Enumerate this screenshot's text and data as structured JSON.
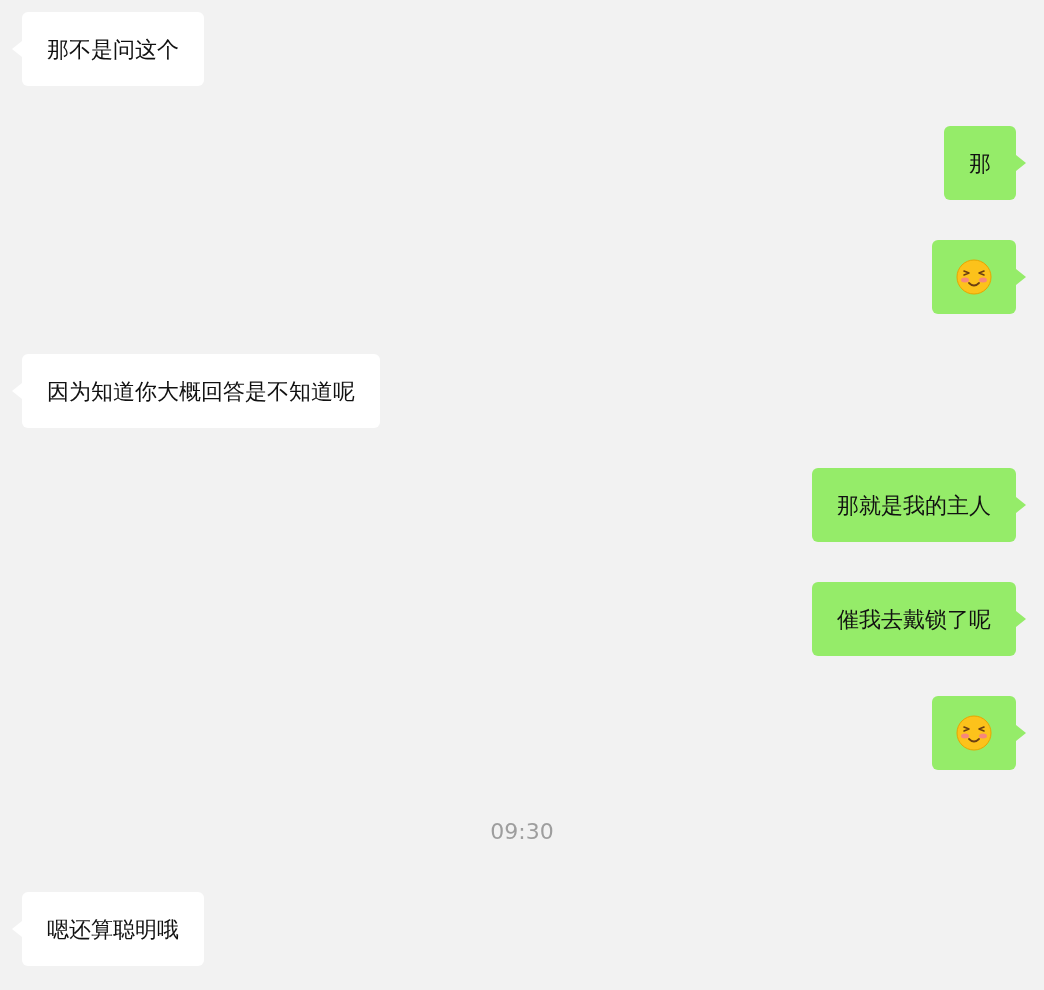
{
  "messages": [
    {
      "kind": "text",
      "outgoing": false,
      "text": "那不是问这个"
    },
    {
      "kind": "text",
      "outgoing": true,
      "text": "那"
    },
    {
      "kind": "sticker",
      "outgoing": true
    },
    {
      "kind": "text",
      "outgoing": false,
      "text": "因为知道你大概回答是不知道呢"
    },
    {
      "kind": "text",
      "outgoing": true,
      "text": "那就是我的主人"
    },
    {
      "kind": "text",
      "outgoing": true,
      "text": "催我去戴锁了呢"
    },
    {
      "kind": "sticker",
      "outgoing": true
    },
    {
      "kind": "time",
      "text": "09:30"
    },
    {
      "kind": "text",
      "outgoing": false,
      "text": "嗯还算聪明哦"
    }
  ]
}
